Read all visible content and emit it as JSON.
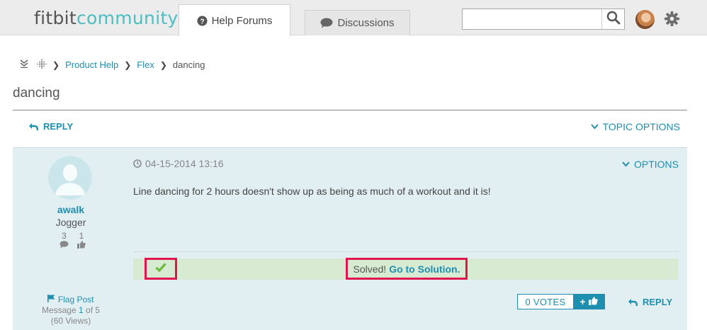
{
  "header": {
    "logo_fit": "fitbit",
    "logo_community": "community",
    "tabs": [
      {
        "label": "Help Forums",
        "icon": "question-circle-icon"
      },
      {
        "label": "Discussions",
        "icon": "speech-bubble-icon"
      }
    ],
    "search": {
      "value": "",
      "placeholder": ""
    }
  },
  "breadcrumb": {
    "items": [
      "Product Help",
      "Flex",
      "dancing"
    ]
  },
  "page_title": "dancing",
  "toolbar": {
    "reply_label": "REPLY",
    "topic_options_label": "TOPIC OPTIONS"
  },
  "post": {
    "author": "awalk",
    "rank": "Jogger",
    "stats": {
      "posts": "3",
      "kudos": "1"
    },
    "date": "04-15-2014 13:16",
    "options_label": "OPTIONS",
    "body": "Line dancing for 2 hours doesn't show up as being as much of a workout and it is!",
    "solved_text": "Solved!",
    "solution_link": "Go to Solution.",
    "flag_label": "Flag Post",
    "message_prefix": "Message",
    "message_index": "1",
    "message_suffix": "of 5",
    "views": "(60 Views)",
    "votes_label": "0 VOTES",
    "vote_plus": "+",
    "reply_label": "REPLY"
  },
  "colors": {
    "accent": "#1f8fb0",
    "logo_teal": "#4cbfc2",
    "highlight": "#e2134d",
    "solved_bg": "#d7ebd2",
    "post_bg": "#e1eef2"
  }
}
